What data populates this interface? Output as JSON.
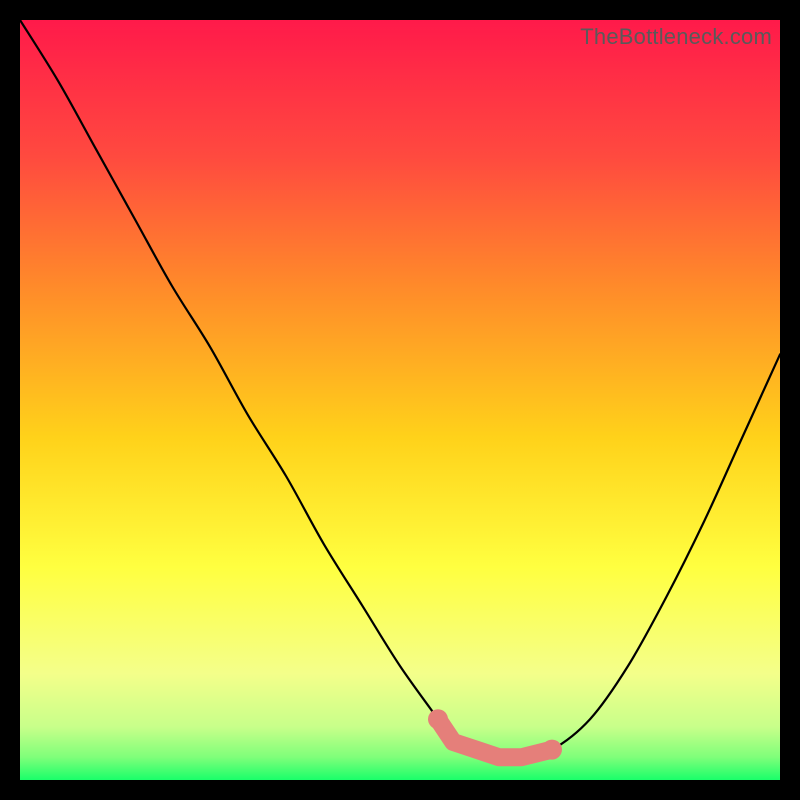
{
  "watermark": "TheBottleneck.com",
  "colors": {
    "bg": "#000000",
    "gradient_top": "#ff1a4a",
    "gradient_mid1": "#ff6a3a",
    "gradient_mid2": "#ffd21a",
    "gradient_mid3": "#ffff40",
    "gradient_mid4": "#f4ff8a",
    "gradient_bottom": "#1aff6a",
    "curve": "#000000",
    "marker": "#e57f7a"
  },
  "chart_data": {
    "type": "line",
    "title": "",
    "xlabel": "",
    "ylabel": "",
    "xlim": [
      0,
      100
    ],
    "ylim": [
      0,
      100
    ],
    "grid": false,
    "legend": false,
    "series": [
      {
        "name": "bottleneck-curve",
        "x": [
          0,
          5,
          10,
          15,
          20,
          25,
          30,
          35,
          40,
          45,
          50,
          55,
          57,
          60,
          63,
          66,
          70,
          75,
          80,
          85,
          90,
          95,
          100
        ],
        "y": [
          100,
          92,
          83,
          74,
          65,
          57,
          48,
          40,
          31,
          23,
          15,
          8,
          5,
          4,
          3,
          3,
          4,
          8,
          15,
          24,
          34,
          45,
          56
        ]
      }
    ],
    "markers": {
      "name": "highlighted-range",
      "x": [
        55,
        57,
        60,
        63,
        66,
        70
      ],
      "y": [
        8,
        5,
        4,
        3,
        3,
        4
      ]
    },
    "annotations": []
  }
}
